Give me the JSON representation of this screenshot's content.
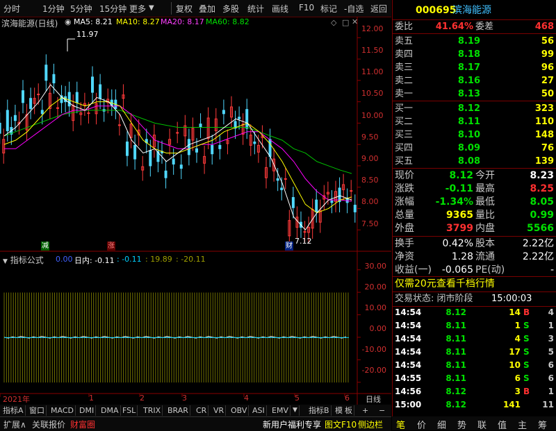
{
  "toolbar": {
    "items": [
      "分时",
      "1分钟",
      "5分钟",
      "15分钟",
      "更多",
      "复权",
      "叠加",
      "多股",
      "统计",
      "画线",
      "F10",
      "标记",
      "-自选",
      "返回"
    ]
  },
  "chart": {
    "title": "滨海能源(日线)",
    "ma": [
      {
        "label": "MA5: 8.21",
        "color": "#ffffff"
      },
      {
        "label": "MA10: 8.27",
        "color": "#ffff00"
      },
      {
        "label": "MA20: 8.17",
        "color": "#ff00ff"
      },
      {
        "label": "MA60: 8.82",
        "color": "#00ff00"
      }
    ],
    "high_label": "11.97",
    "low_label": "7.12",
    "y_ticks": [
      "12.00",
      "11.50",
      "11.00",
      "10.50",
      "10.00",
      "9.50",
      "9.00",
      "8.50",
      "8.00",
      "7.50"
    ],
    "markers": {
      "jian": "减",
      "zhang": "涨",
      "cai": "财"
    },
    "indicator_title": "指标公式",
    "indicator_values": [
      {
        "text": "0.00",
        "color": "#4060ff"
      },
      {
        "text": "日内: -0.11",
        "color": "#ffffff"
      },
      {
        "text": ": -0.11",
        "color": "#00d0ff"
      },
      {
        "text": ": 19.89",
        "color": "#a0a000"
      },
      {
        "text": ": -20.11",
        "color": "#a0a000"
      }
    ],
    "ind_y_ticks": [
      "30.00",
      "20.00",
      "10.00",
      "0.00",
      "-10.00",
      "-20.00"
    ],
    "x_ticks": [
      "2021年",
      "1",
      "2",
      "3",
      "4",
      "5",
      "6"
    ],
    "x_right_label": "日线"
  },
  "chart_data": {
    "type": "candlestick",
    "title": "滨海能源(日线)",
    "ylim": [
      7.0,
      12.2
    ],
    "y_ticks": [
      12.0,
      11.5,
      11.0,
      10.5,
      10.0,
      9.5,
      9.0,
      8.5,
      8.0,
      7.5
    ],
    "high": 11.97,
    "low": 7.12,
    "ma_latest": {
      "MA5": 8.21,
      "MA10": 8.27,
      "MA20": 8.17,
      "MA60": 8.82
    },
    "ma5": [
      9.7,
      9.9,
      10.2,
      10.5,
      10.9,
      10.6,
      10.4,
      10.3,
      10.6,
      10.5,
      10.2,
      9.6,
      9.3,
      9.4,
      9.1,
      9.3,
      9.5,
      9.6,
      9.7,
      9.9,
      10.1,
      10.0,
      9.6,
      9.2,
      8.6,
      7.8,
      7.5,
      7.9,
      8.2,
      8.3,
      8.2
    ],
    "ma10": [
      9.5,
      9.6,
      9.8,
      10.1,
      10.4,
      10.6,
      10.5,
      10.4,
      10.5,
      10.5,
      10.4,
      10.0,
      9.6,
      9.4,
      9.3,
      9.3,
      9.4,
      9.5,
      9.6,
      9.8,
      9.9,
      10.0,
      9.8,
      9.5,
      9.1,
      8.6,
      8.1,
      7.9,
      8.0,
      8.2,
      8.27
    ],
    "ma20": [
      9.4,
      9.4,
      9.6,
      9.8,
      10.0,
      10.2,
      10.3,
      10.3,
      10.4,
      10.4,
      10.4,
      10.2,
      9.9,
      9.6,
      9.5,
      9.4,
      9.4,
      9.5,
      9.5,
      9.6,
      9.7,
      9.8,
      9.8,
      9.6,
      9.4,
      9.1,
      8.7,
      8.4,
      8.2,
      8.2,
      8.17
    ],
    "ma60": [
      9.7,
      9.8,
      9.9,
      10.0,
      10.1,
      10.2,
      10.25,
      10.3,
      10.3,
      10.3,
      10.3,
      10.2,
      10.1,
      10.0,
      9.95,
      9.9,
      9.9,
      9.9,
      9.9,
      9.9,
      9.9,
      9.9,
      9.8,
      9.7,
      9.6,
      9.4,
      9.3,
      9.1,
      9.0,
      8.9,
      8.82
    ],
    "indicator": {
      "name": "日内",
      "values": {
        "line0": 0.0,
        "rinei": -0.11,
        "a": -0.11,
        "b": 19.89,
        "c": -20.11
      },
      "ylim": [
        -25,
        33
      ]
    }
  },
  "quote": {
    "code": "000695",
    "name": "滨海能源",
    "weibi_label": "委比",
    "weibi": "41.64%",
    "weicha_label": "委差",
    "weicha": "468",
    "asks": [
      {
        "label": "卖五",
        "price": "8.19",
        "vol": "56"
      },
      {
        "label": "卖四",
        "price": "8.18",
        "vol": "99"
      },
      {
        "label": "卖三",
        "price": "8.17",
        "vol": "96"
      },
      {
        "label": "卖二",
        "price": "8.16",
        "vol": "27"
      },
      {
        "label": "卖一",
        "price": "8.13",
        "vol": "50"
      }
    ],
    "bids": [
      {
        "label": "买一",
        "price": "8.12",
        "vol": "323"
      },
      {
        "label": "买二",
        "price": "8.11",
        "vol": "110"
      },
      {
        "label": "买三",
        "price": "8.10",
        "vol": "148"
      },
      {
        "label": "买四",
        "price": "8.09",
        "vol": "76"
      },
      {
        "label": "买五",
        "price": "8.08",
        "vol": "139"
      }
    ],
    "stats": [
      {
        "l1": "现价",
        "v1": "8.12",
        "c1": "#00e000",
        "l2": "今开",
        "v2": "8.23",
        "c2": "#ffffff"
      },
      {
        "l1": "涨跌",
        "v1": "-0.11",
        "c1": "#00e000",
        "l2": "最高",
        "v2": "8.25",
        "c2": "#ff3030"
      },
      {
        "l1": "涨幅",
        "v1": "-1.34%",
        "c1": "#00e000",
        "l2": "最低",
        "v2": "8.05",
        "c2": "#00e000"
      },
      {
        "l1": "总量",
        "v1": "9365",
        "c1": "#ffff00",
        "l2": "量比",
        "v2": "0.99",
        "c2": "#00e000"
      },
      {
        "l1": "外盘",
        "v1": "3799",
        "c1": "#ff3030",
        "l2": "内盘",
        "v2": "5566",
        "c2": "#00e000"
      }
    ],
    "fin": [
      {
        "l1": "换手",
        "v1": "0.42%",
        "l2": "股本",
        "v2": "2.22亿"
      },
      {
        "l1": "净资",
        "v1": "1.28",
        "l2": "流通",
        "v2": "2.22亿"
      },
      {
        "l1": "收益(一)",
        "v1": "-0.065",
        "l2": "PE(动)",
        "v2": "-"
      }
    ],
    "promo": "仅需20元查看千档行情",
    "trade_status_label": "交易状态: 闭市阶段",
    "trade_status_time": "15:00:03",
    "ticks": [
      {
        "t": "14:54",
        "p": "8.12",
        "v": "14",
        "s": "B",
        "n": "4"
      },
      {
        "t": "14:54",
        "p": "8.11",
        "v": "1",
        "s": "S",
        "n": "1"
      },
      {
        "t": "14:54",
        "p": "8.11",
        "v": "4",
        "s": "S",
        "n": "3"
      },
      {
        "t": "14:54",
        "p": "8.11",
        "v": "17",
        "s": "S",
        "n": "5"
      },
      {
        "t": "14:54",
        "p": "8.11",
        "v": "10",
        "s": "S",
        "n": "6"
      },
      {
        "t": "14:55",
        "p": "8.11",
        "v": "6",
        "s": "S",
        "n": "6"
      },
      {
        "t": "14:56",
        "p": "8.12",
        "v": "3",
        "s": "B",
        "n": "1"
      },
      {
        "t": "15:00",
        "p": "8.12",
        "v": "141",
        "s": "",
        "n": "11"
      }
    ]
  },
  "bottom_tabs": [
    "指标A",
    "窗口",
    "MACD",
    "DMI",
    "DMA",
    "FSL",
    "TRIX",
    "BRAR",
    "CR",
    "VR",
    "OBV",
    "ASI",
    "EMV",
    "▼",
    "指标B",
    "模",
    "板",
    "+",
    "−"
  ],
  "status": {
    "left": [
      "扩展∧",
      "关联报价",
      "财富圈"
    ],
    "right": [
      "新用户福利专享",
      "图文F10",
      "侧边栏"
    ]
  },
  "right_tabs": [
    "笔",
    "价",
    "细",
    "势",
    "联",
    "值",
    "主",
    "筹"
  ]
}
